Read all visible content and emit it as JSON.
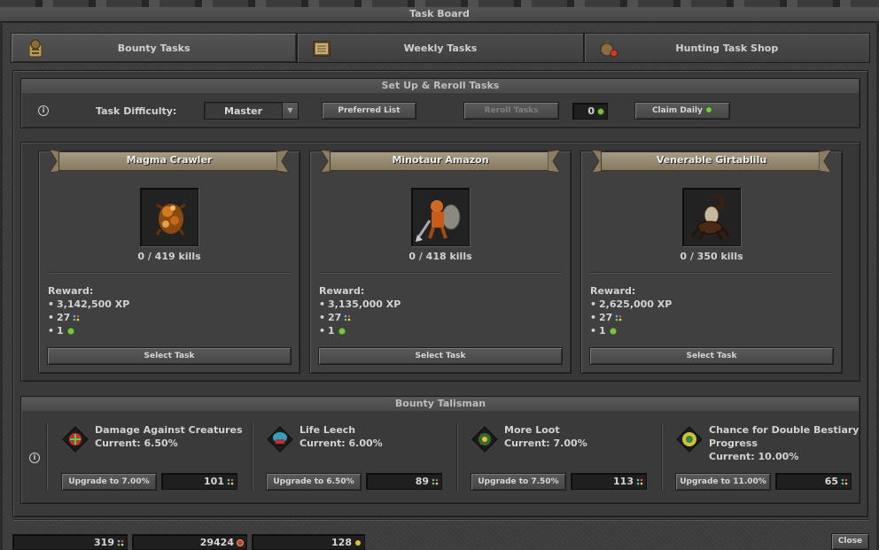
{
  "window": {
    "title": "Task Board"
  },
  "tabs": [
    {
      "label": "Bounty Tasks",
      "icon": "bounty-scroll-icon",
      "active": true
    },
    {
      "label": "Weekly Tasks",
      "icon": "weekly-ledger-icon",
      "active": false
    },
    {
      "label": "Hunting Task Shop",
      "icon": "shop-bag-icon",
      "active": false
    }
  ],
  "setup": {
    "heading": "Set Up & Reroll Tasks",
    "difficulty_label": "Task Difficulty:",
    "difficulty_value": "Master",
    "preferred_list": "Preferred List",
    "reroll": "Reroll Tasks",
    "reroll_count": "0",
    "claim_daily": "Claim Daily"
  },
  "tasks": [
    {
      "monster": "Magma Crawler",
      "kills": "0 / 419 kills",
      "reward_label": "Reward:",
      "xp": "3,142,500 XP",
      "points": "27",
      "tokens": "1",
      "select": "Select Task"
    },
    {
      "monster": "Minotaur Amazon",
      "kills": "0 / 418 kills",
      "reward_label": "Reward:",
      "xp": "3,135,000 XP",
      "points": "27",
      "tokens": "1",
      "select": "Select Task"
    },
    {
      "monster": "Venerable Girtablilu",
      "kills": "0 / 350 kills",
      "reward_label": "Reward:",
      "xp": "2,625,000 XP",
      "points": "27",
      "tokens": "1",
      "select": "Select Task"
    }
  ],
  "talisman": {
    "heading": "Bounty Talisman",
    "items": [
      {
        "name": "Damage Against Creatures",
        "current": "Current: 6.50%",
        "upgrade": "Upgrade to 7.00%",
        "cost": "101",
        "icon": "damage-talisman-icon"
      },
      {
        "name": "Life Leech",
        "current": "Current: 6.00%",
        "upgrade": "Upgrade to 6.50%",
        "cost": "89",
        "icon": "life-leech-talisman-icon"
      },
      {
        "name": "More Loot",
        "current": "Current: 7.00%",
        "upgrade": "Upgrade to 7.50%",
        "cost": "113",
        "icon": "loot-talisman-icon"
      },
      {
        "name": "Chance for Double Bestiary Progress",
        "current": "Current: 10.00%",
        "upgrade": "Upgrade to 11.00%",
        "cost": "65",
        "icon": "bestiary-talisman-icon"
      }
    ]
  },
  "footer": {
    "currency1": "319",
    "currency2": "29424",
    "currency3": "128",
    "close": "Close"
  },
  "colors": {
    "banner": "#a59a85",
    "gem_blue": "#6fa8ff",
    "token_green": "#7cc24a"
  }
}
